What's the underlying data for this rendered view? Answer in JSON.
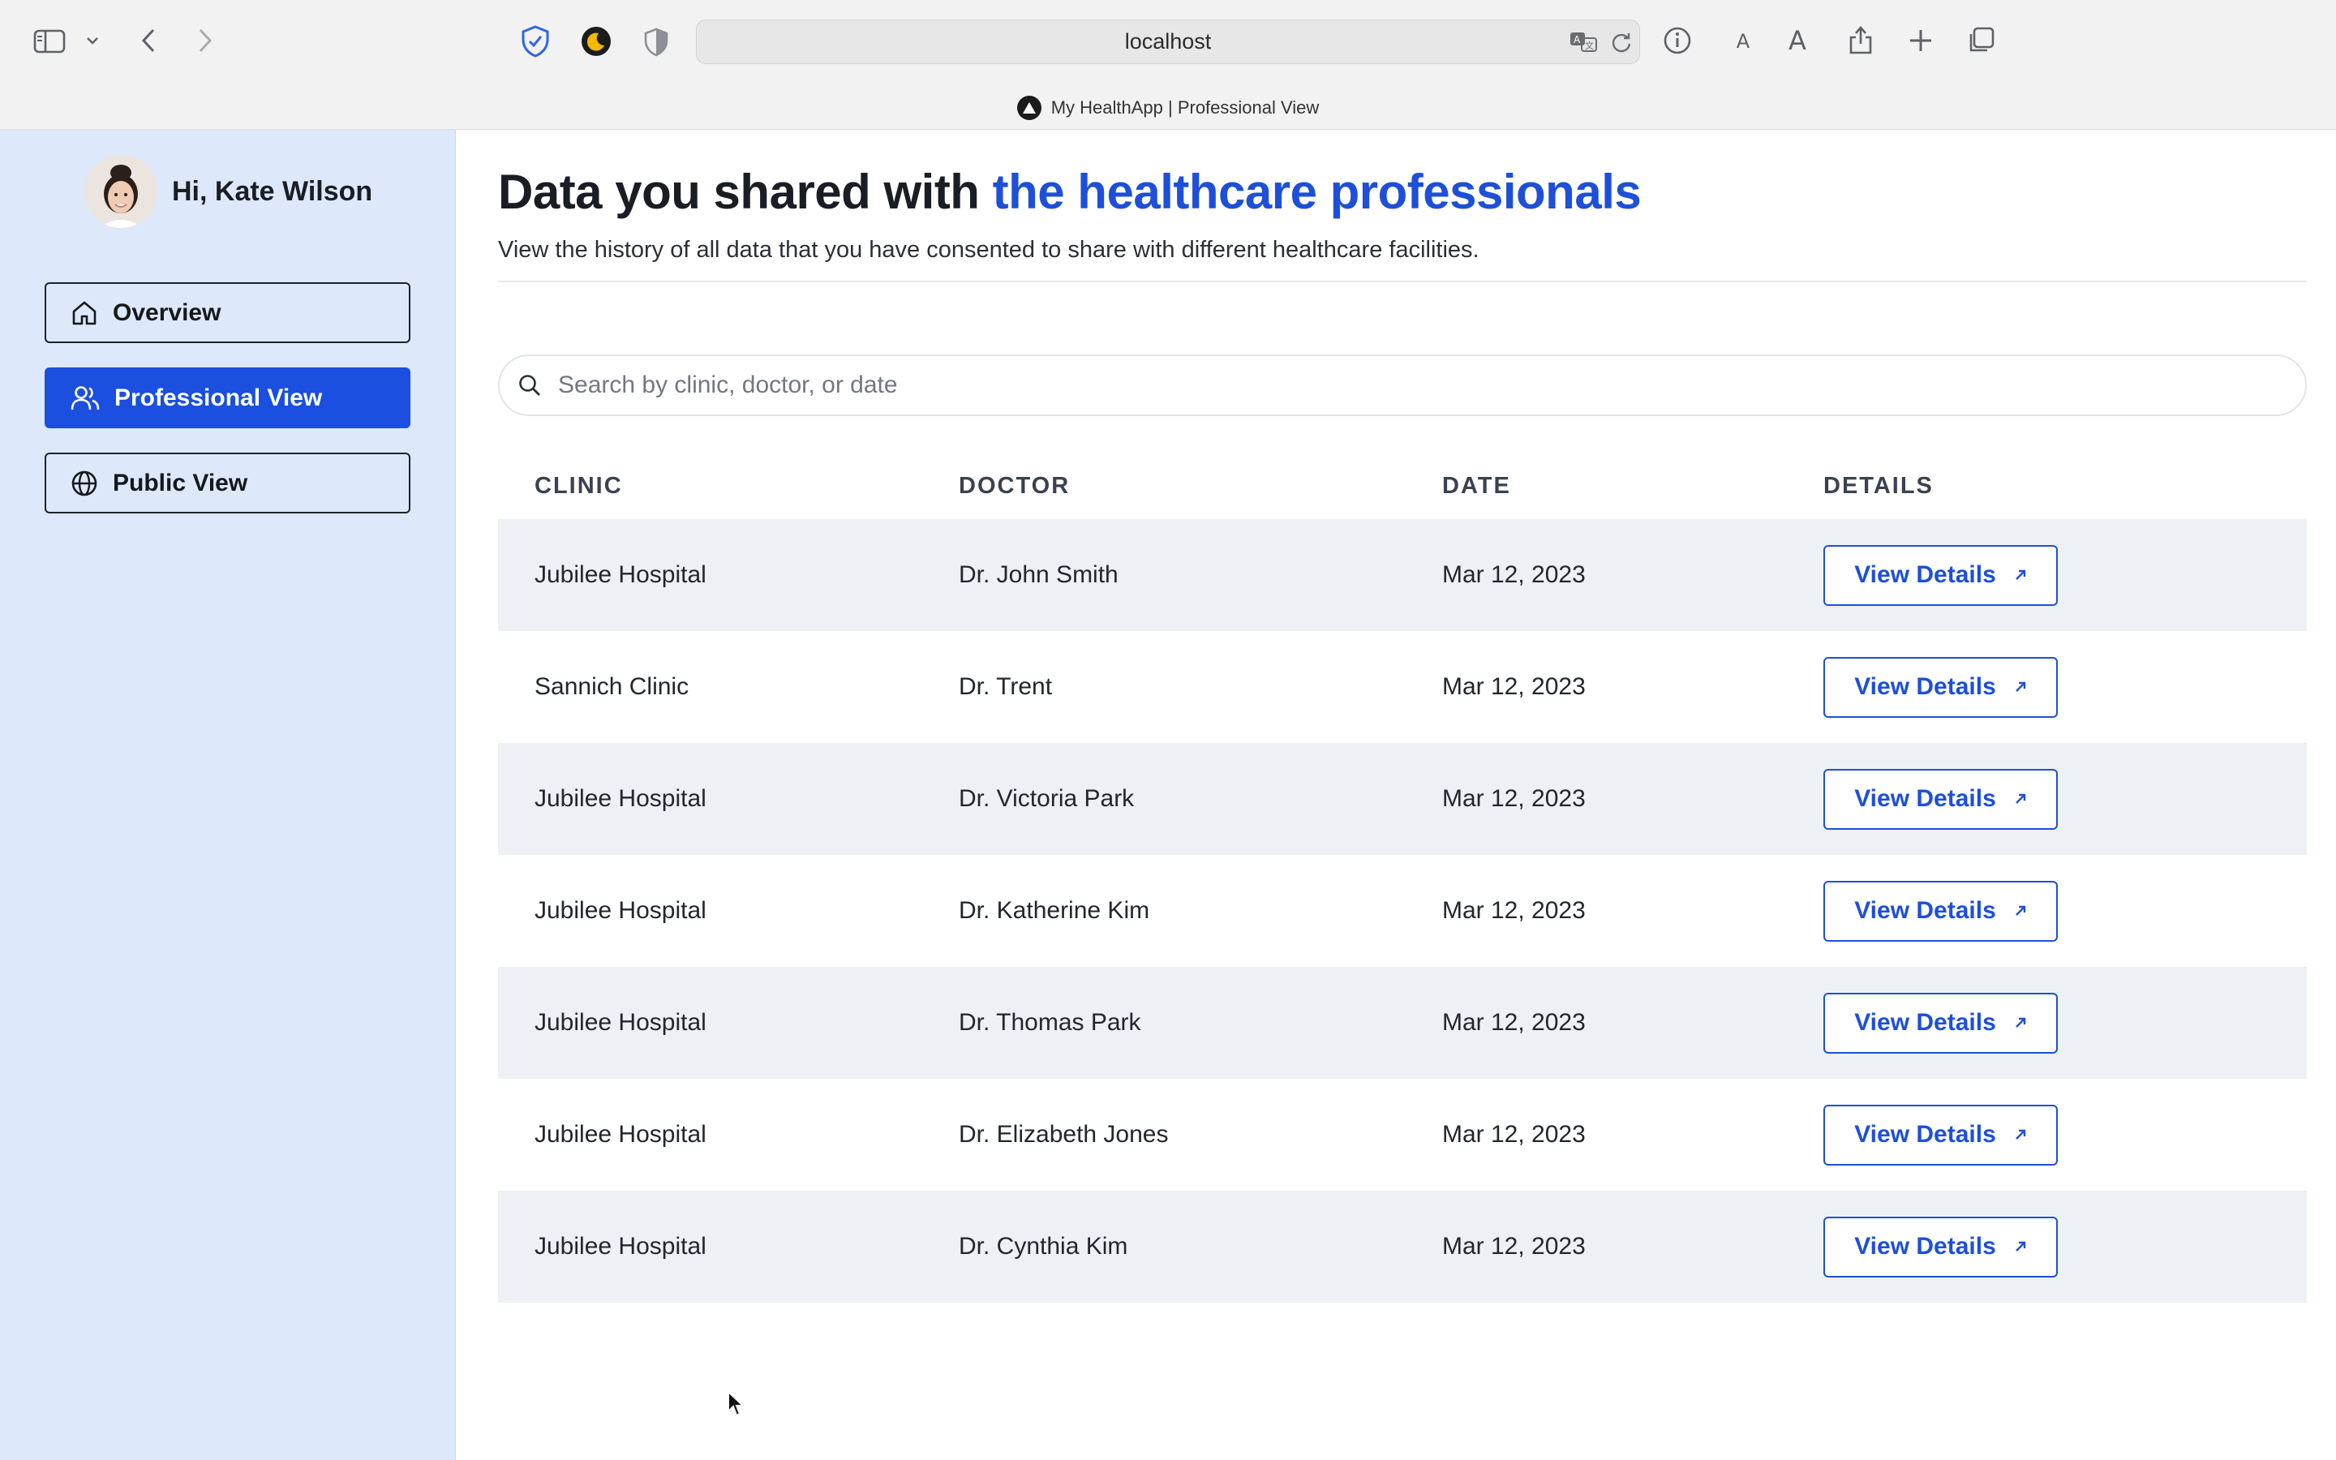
{
  "browser": {
    "url": "localhost",
    "tab_title": "My HealthApp | Professional View"
  },
  "sidebar": {
    "greeting": "Hi, Kate Wilson",
    "items": [
      {
        "label": "Overview",
        "icon": "home-icon",
        "active": false
      },
      {
        "label": "Professional View",
        "icon": "users-icon",
        "active": true
      },
      {
        "label": "Public View",
        "icon": "globe-icon",
        "active": false
      }
    ]
  },
  "main": {
    "title_plain": "Data you shared with ",
    "title_accent": "the healthcare professionals",
    "subtitle": "View the history of all data that you have consented to share with different healthcare facilities.",
    "search_placeholder": "Search by clinic, doctor, or date",
    "table": {
      "headers": [
        "CLINIC",
        "DOCTOR",
        "DATE",
        "DETAILS"
      ],
      "button_label": "View Details",
      "rows": [
        {
          "clinic": "Jubilee Hospital",
          "doctor": "Dr. John Smith",
          "date": "Mar 12, 2023"
        },
        {
          "clinic": "Sannich Clinic",
          "doctor": "Dr. Trent",
          "date": "Mar 12, 2023"
        },
        {
          "clinic": "Jubilee Hospital",
          "doctor": "Dr. Victoria Park",
          "date": "Mar 12, 2023"
        },
        {
          "clinic": "Jubilee Hospital",
          "doctor": "Dr. Katherine Kim",
          "date": "Mar 12, 2023"
        },
        {
          "clinic": "Jubilee Hospital",
          "doctor": "Dr. Thomas Park",
          "date": "Mar 12, 2023"
        },
        {
          "clinic": "Jubilee Hospital",
          "doctor": "Dr. Elizabeth Jones",
          "date": "Mar 12, 2023"
        },
        {
          "clinic": "Jubilee Hospital",
          "doctor": "Dr. Cynthia Kim",
          "date": "Mar 12, 2023"
        }
      ]
    }
  },
  "colors": {
    "accent": "#1d4fd8",
    "active_nav": "#1a4fe0",
    "sidebar_bg": "#dde8fa",
    "row_stripe": "#edf1f6"
  }
}
